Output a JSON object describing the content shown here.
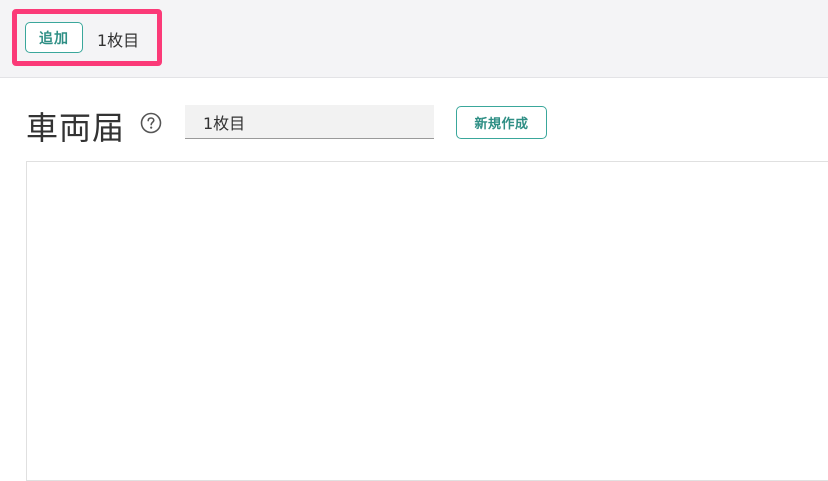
{
  "toolbar": {
    "add_label": "追加",
    "page_label": "1枚目"
  },
  "form": {
    "title": "車両届",
    "help_icon": "question-circle-icon",
    "page_value": "1枚目",
    "new_label": "新規作成"
  },
  "colors": {
    "highlight": "#fb3a78",
    "accent": "#3aa79b",
    "topbar_bg": "#f4f4f6"
  }
}
